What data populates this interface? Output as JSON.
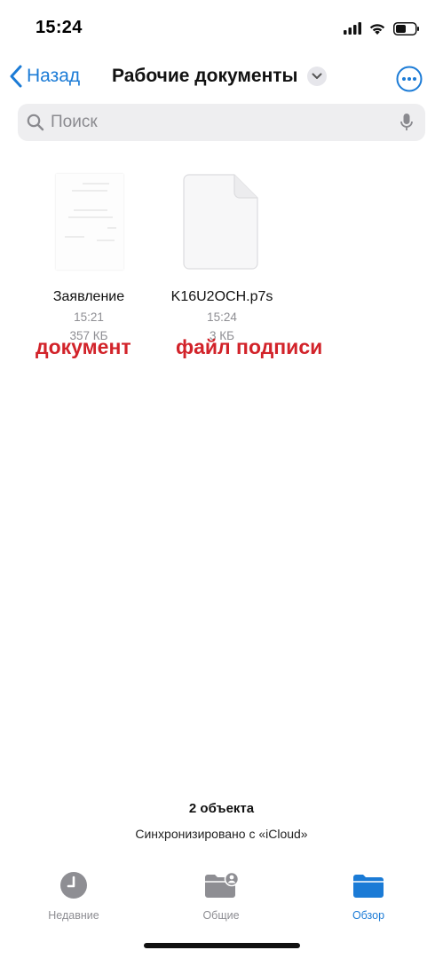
{
  "status_bar": {
    "time": "15:24",
    "icons": [
      "signal-icon",
      "wifi-icon",
      "battery-icon"
    ]
  },
  "nav": {
    "back_label": "Назад",
    "title": "Рабочие документы",
    "accent_color": "#1b7bd6"
  },
  "search": {
    "placeholder": "Поиск"
  },
  "files": [
    {
      "name": "Заявление",
      "time": "15:21",
      "size": "357 КБ",
      "annotation": "документ"
    },
    {
      "name": "K16U2OCH.p7s",
      "time": "15:24",
      "size": "3 КБ",
      "annotation": "файл подписи"
    }
  ],
  "summary": {
    "count": "2 объекта",
    "sync": "Синхронизировано с «iCloud»"
  },
  "tabs": [
    {
      "label": "Недавние",
      "icon": "clock-icon",
      "active": false
    },
    {
      "label": "Общие",
      "icon": "shared-folder-icon",
      "active": false
    },
    {
      "label": "Обзор",
      "icon": "folder-icon",
      "active": true
    }
  ],
  "colors": {
    "annotation_red": "#d2232a",
    "inactive_gray": "#8e8e93"
  }
}
